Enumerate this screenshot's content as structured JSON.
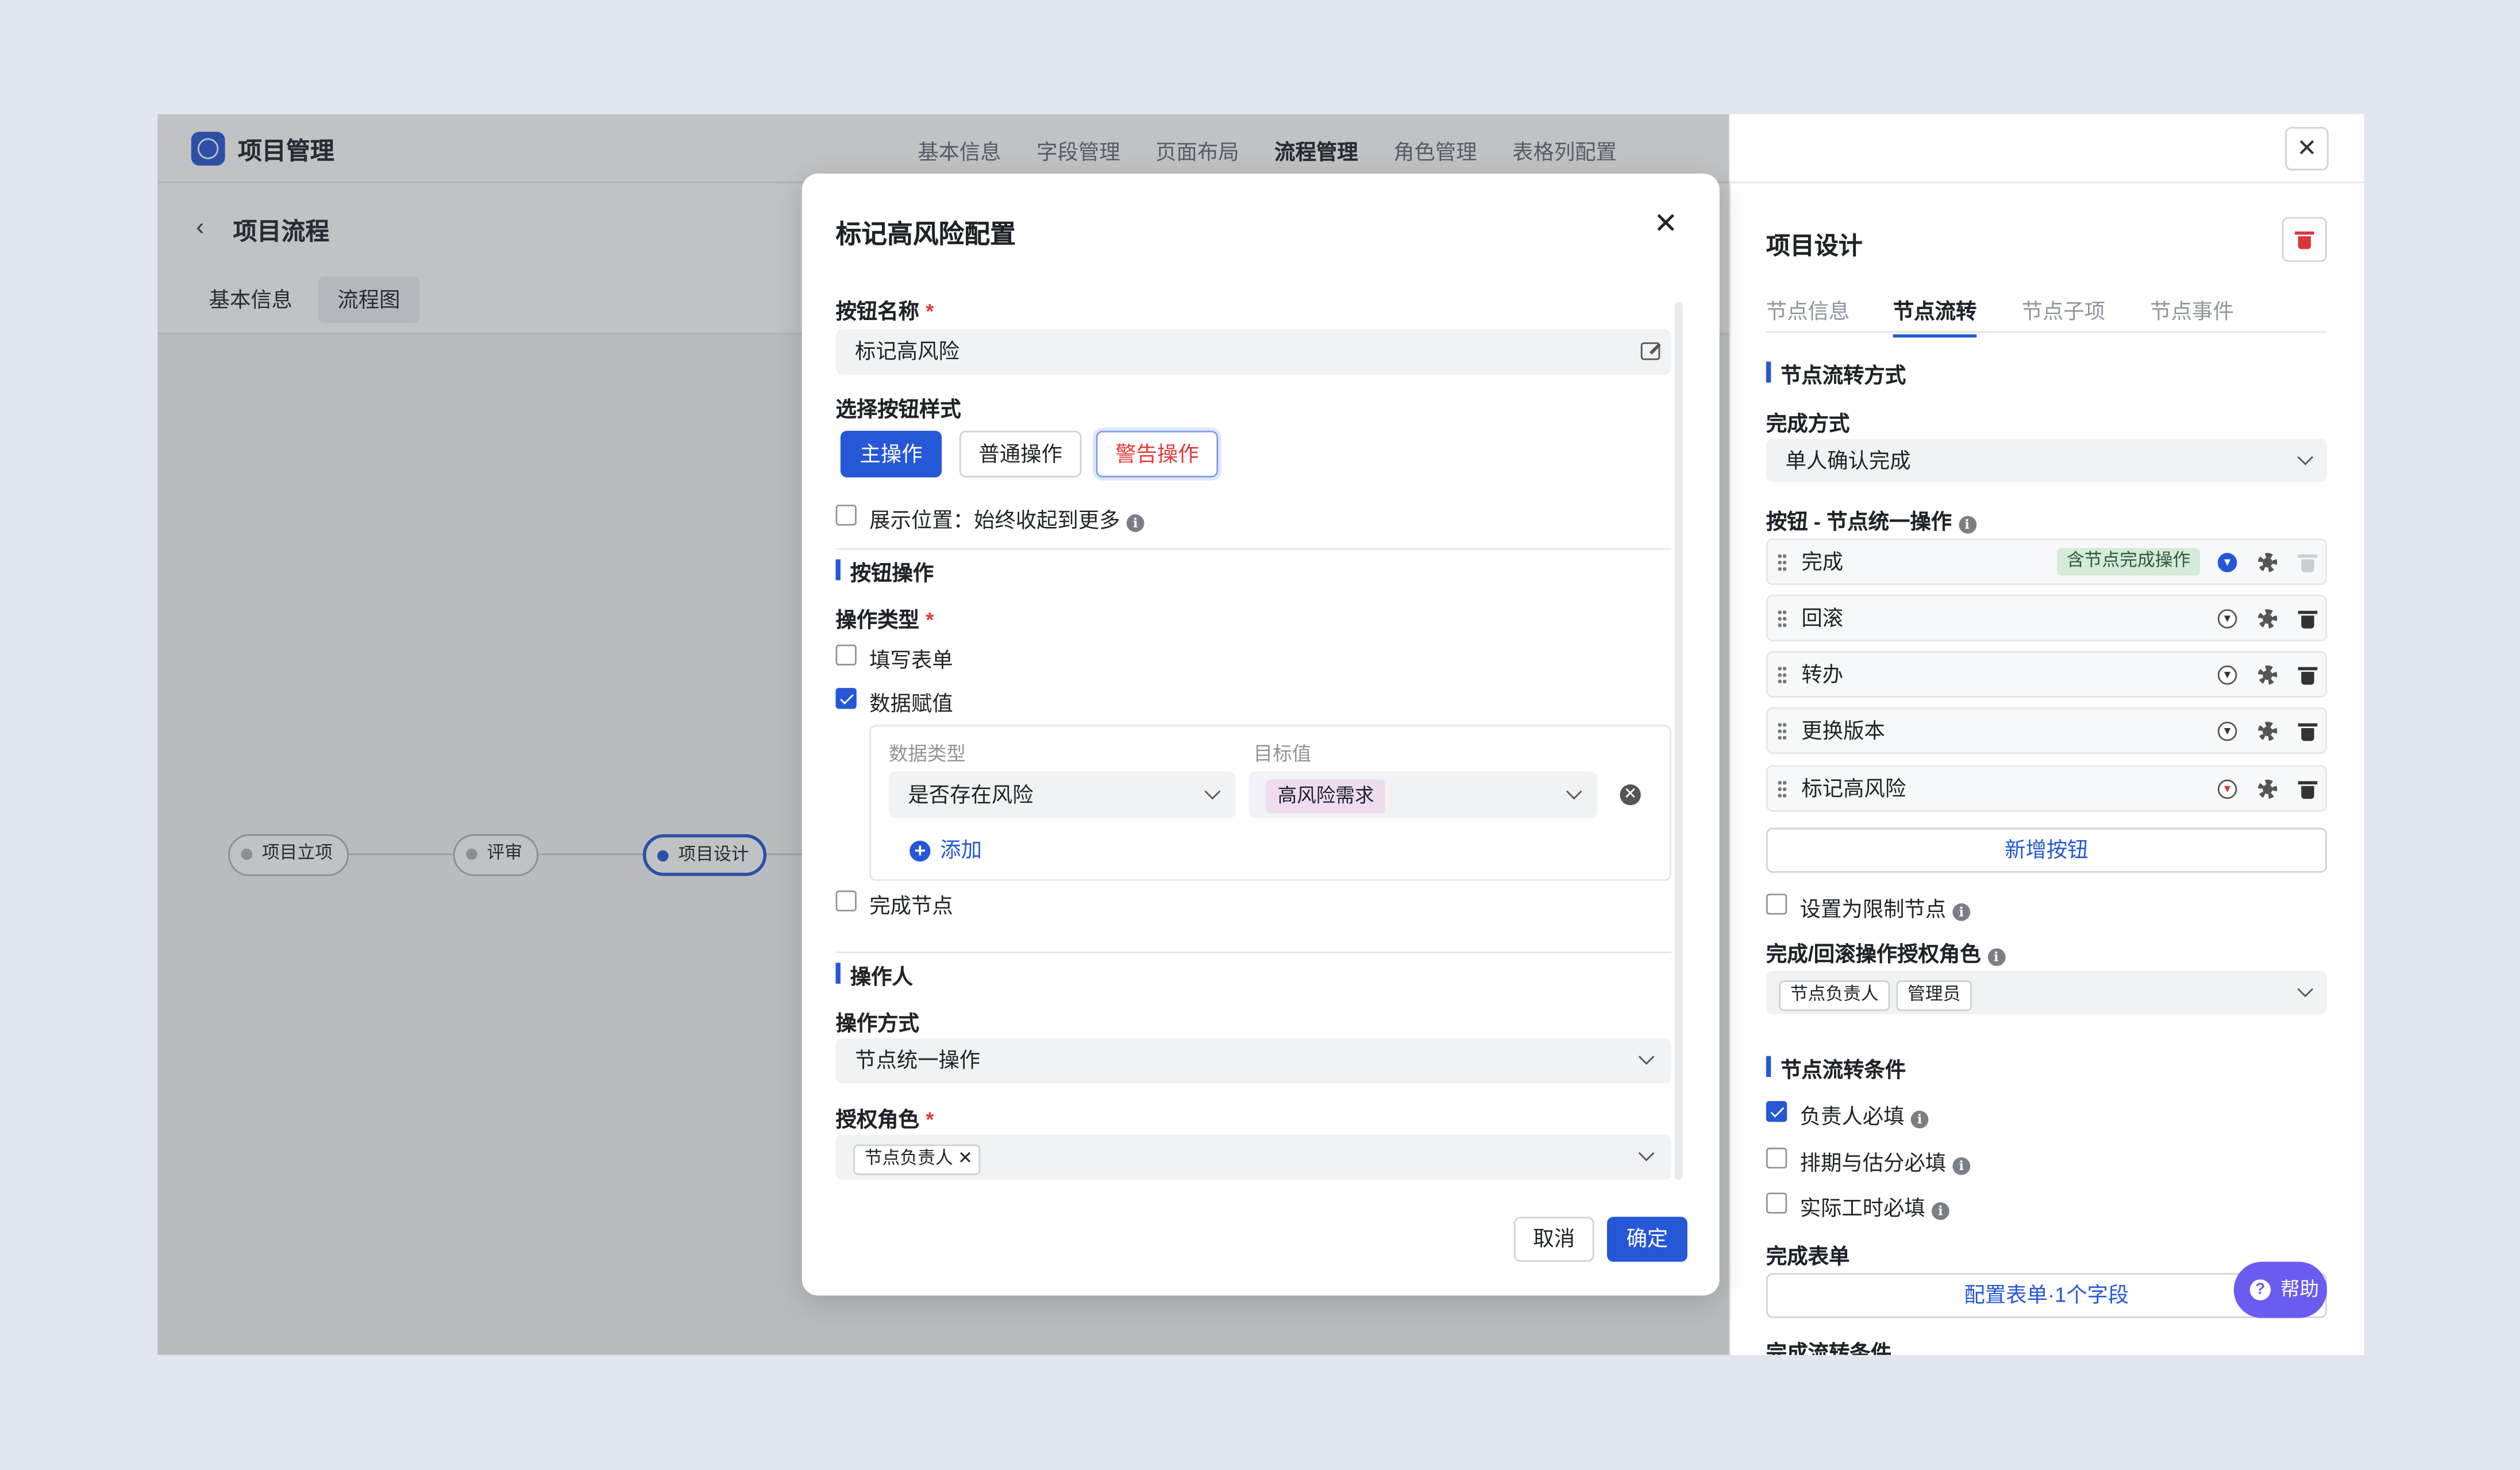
{
  "app": {
    "title": "项目管理",
    "close_icon": "close-icon"
  },
  "nav_tabs": [
    "基本信息",
    "字段管理",
    "页面布局",
    "流程管理",
    "角色管理",
    "表格列配置"
  ],
  "left": {
    "back_icon": "chevron-left-icon",
    "title": "项目流程",
    "tabs": [
      "基本信息",
      "流程图"
    ],
    "flow_nodes": [
      "项目立项",
      "评审",
      "项目设计"
    ]
  },
  "right": {
    "title": "项目设计",
    "tabs": [
      "节点信息",
      "节点流转",
      "节点子项",
      "节点事件"
    ],
    "section_flow_mode": "节点流转方式",
    "complete_mode_label": "完成方式",
    "complete_mode_value": "单人确认完成",
    "buttons_label": "按钮 - 节点统一操作",
    "button_rows": [
      {
        "name": "完成",
        "tag": "含节点完成操作"
      },
      {
        "name": "回滚"
      },
      {
        "name": "转办"
      },
      {
        "name": "更换版本"
      },
      {
        "name": "标记高风险"
      }
    ],
    "add_button": "新增按钮",
    "restrict_node_label": "设置为限制节点",
    "roles_label": "完成/回滚操作授权角色",
    "roles": [
      "节点负责人",
      "管理员"
    ],
    "section_conditions": "节点流转条件",
    "conditions": [
      {
        "label": "负责人必填",
        "checked": true
      },
      {
        "label": "排期与估分必填",
        "checked": false
      },
      {
        "label": "实际工时必填",
        "checked": false
      }
    ],
    "complete_form_label": "完成表单",
    "complete_form_button": "配置表单·1个字段",
    "complete_flow_conditions": "完成流转条件",
    "help": "帮助"
  },
  "modal": {
    "title": "标记高风险配置",
    "button_name_label": "按钮名称",
    "button_name_value": "标记高风险",
    "style_label": "选择按钮样式",
    "styles": [
      "主操作",
      "普通操作",
      "警告操作"
    ],
    "show_position_label": "展示位置：始终收起到更多",
    "section_button_op": "按钮操作",
    "op_type_label": "操作类型",
    "op_fill_form": "填写表单",
    "op_assign": "数据赋值",
    "data_type_label": "数据类型",
    "data_type_value": "是否存在风险",
    "target_label": "目标值",
    "target_value": "高风险需求",
    "add_label": "添加",
    "complete_node": "完成节点",
    "section_operator": "操作人",
    "op_mode_label": "操作方式",
    "op_mode_value": "节点统一操作",
    "auth_roles_label": "授权角色",
    "auth_role_chip": "节点负责人",
    "cancel": "取消",
    "confirm": "确定"
  },
  "colors": {
    "accent": "#2557d6",
    "danger": "#e03a3a",
    "help": "#6a5cf0"
  }
}
